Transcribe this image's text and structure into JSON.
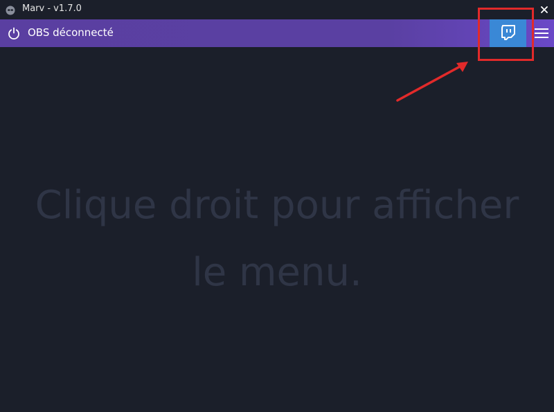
{
  "window": {
    "title": "Marv - v1.7.0",
    "close_symbol": "✕",
    "app_icon": "marv-logo-icon"
  },
  "toolbar": {
    "obs_status": "OBS déconnecté",
    "power_icon": "power-icon",
    "twitch_icon": "twitch-icon",
    "menu_icon": "hamburger-menu-icon",
    "colors": {
      "toolbar_bg": "#5a40a2",
      "twitch_button_bg": "#3a88d6"
    }
  },
  "main": {
    "empty_message_line1": "Clique droit pour afficher",
    "empty_message_line2": "le menu."
  },
  "annotation": {
    "color": "#e22a2a"
  }
}
